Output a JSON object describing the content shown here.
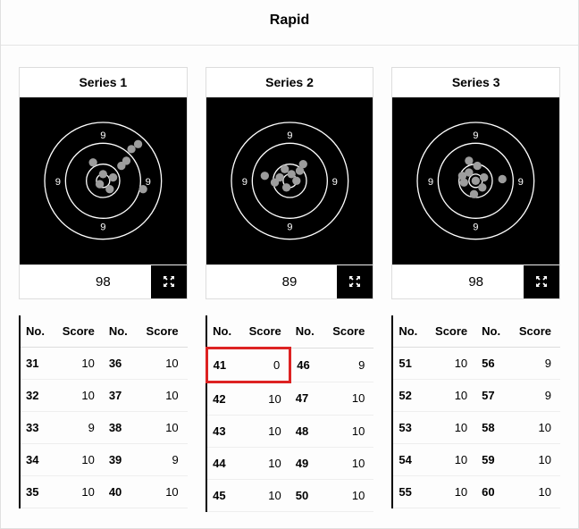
{
  "title": "Rapid",
  "headers": {
    "no": "No.",
    "score": "Score"
  },
  "series": [
    {
      "label": "Series 1",
      "total": "98",
      "shots": [
        {
          "no": "31",
          "score": "10"
        },
        {
          "no": "32",
          "score": "10"
        },
        {
          "no": "33",
          "score": "9"
        },
        {
          "no": "34",
          "score": "10"
        },
        {
          "no": "35",
          "score": "10"
        },
        {
          "no": "36",
          "score": "10"
        },
        {
          "no": "37",
          "score": "10"
        },
        {
          "no": "38",
          "score": "10"
        },
        {
          "no": "39",
          "score": "9"
        },
        {
          "no": "40",
          "score": "10"
        }
      ],
      "hits": [
        [
          88,
          78
        ],
        [
          100,
          92
        ],
        [
          128,
          76
        ],
        [
          142,
          56
        ],
        [
          134,
          62
        ],
        [
          108,
          110
        ],
        [
          148,
          110
        ],
        [
          112,
          96
        ],
        [
          96,
          104
        ],
        [
          122,
          82
        ]
      ]
    },
    {
      "label": "Series 2",
      "total": "89",
      "shots": [
        {
          "no": "41",
          "score": "0",
          "highlight": true
        },
        {
          "no": "42",
          "score": "10"
        },
        {
          "no": "43",
          "score": "10"
        },
        {
          "no": "44",
          "score": "10"
        },
        {
          "no": "45",
          "score": "10"
        },
        {
          "no": "46",
          "score": "9"
        },
        {
          "no": "47",
          "score": "10"
        },
        {
          "no": "48",
          "score": "10"
        },
        {
          "no": "49",
          "score": "10"
        },
        {
          "no": "50",
          "score": "10"
        }
      ],
      "hits": [
        [
          70,
          94
        ],
        [
          82,
          102
        ],
        [
          94,
          86
        ],
        [
          102,
          92
        ],
        [
          108,
          100
        ],
        [
          112,
          88
        ],
        [
          96,
          108
        ],
        [
          88,
          96
        ],
        [
          116,
          80
        ]
      ]
    },
    {
      "label": "Series 3",
      "total": "98",
      "shots": [
        {
          "no": "51",
          "score": "10"
        },
        {
          "no": "52",
          "score": "10"
        },
        {
          "no": "53",
          "score": "10"
        },
        {
          "no": "54",
          "score": "10"
        },
        {
          "no": "55",
          "score": "10"
        },
        {
          "no": "56",
          "score": "9"
        },
        {
          "no": "57",
          "score": "9"
        },
        {
          "no": "58",
          "score": "10"
        },
        {
          "no": "59",
          "score": "10"
        },
        {
          "no": "60",
          "score": "10"
        }
      ],
      "hits": [
        [
          92,
          90
        ],
        [
          102,
          82
        ],
        [
          110,
          96
        ],
        [
          86,
          102
        ],
        [
          98,
          116
        ],
        [
          132,
          98
        ],
        [
          100,
          100
        ],
        [
          108,
          108
        ],
        [
          92,
          76
        ],
        [
          84,
          94
        ]
      ]
    }
  ],
  "ring_label": "9"
}
